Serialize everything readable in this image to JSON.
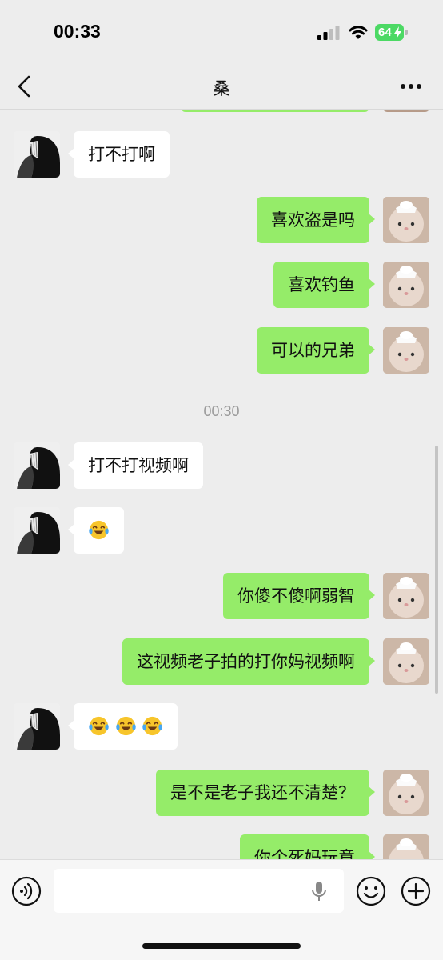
{
  "status_bar": {
    "time": "00:33",
    "battery": "64"
  },
  "nav": {
    "title": "桑"
  },
  "messages": [
    {
      "side": "left",
      "text": "打不打啊"
    },
    {
      "side": "right",
      "text": "喜欢盗是吗"
    },
    {
      "side": "right",
      "text": "喜欢钓鱼"
    },
    {
      "side": "right",
      "text": "可以的兄弟"
    },
    {
      "timestamp": "00:30"
    },
    {
      "side": "left",
      "text": "打不打视频啊"
    },
    {
      "side": "left",
      "emoji_count": 1,
      "emoji": "laughing-tears-emoji"
    },
    {
      "side": "right",
      "text": "你傻不傻啊弱智"
    },
    {
      "side": "right",
      "text": "这视频老子拍的打你妈视频啊"
    },
    {
      "side": "left",
      "emoji_count": 3,
      "emoji": "laughing-tears-emoji"
    },
    {
      "side": "right",
      "text": "是不是老子我还不清楚？"
    },
    {
      "side": "right",
      "text": "你个死妈玩意"
    }
  ],
  "input": {
    "value": "",
    "placeholder": ""
  },
  "colors": {
    "background": "#ededed",
    "bubble_self": "#95ec69",
    "bubble_other": "#ffffff",
    "battery": "#4cd964"
  },
  "icons": [
    "back-icon",
    "more-icon",
    "voice-icon",
    "mic-icon",
    "emoji-icon",
    "plus-icon"
  ]
}
